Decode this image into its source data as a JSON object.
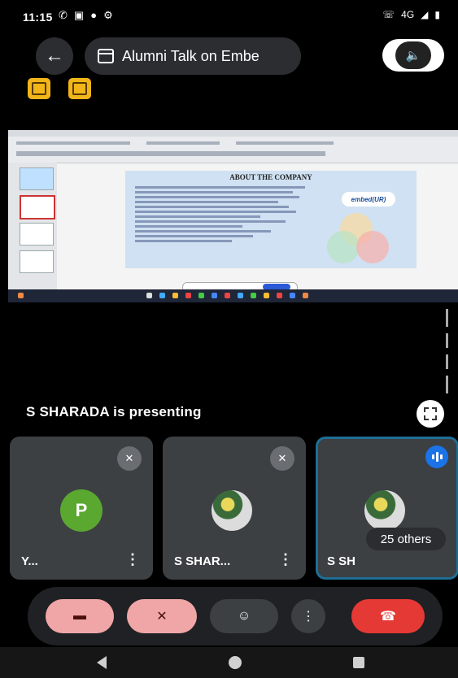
{
  "status_bar": {
    "time": "11:15",
    "left_icons": [
      "missed-call-icon",
      "calendar-31-icon",
      "chat-bubble-icon",
      "settings-icon"
    ],
    "network": "4G"
  },
  "header": {
    "meeting_title": "Alumni Talk on Embe",
    "back_label": "←",
    "speaker_glyph": "🔈"
  },
  "shared_screen": {
    "slide_heading": "ABOUT THE COMPANY",
    "logo_text": "embed(UR)"
  },
  "presenting_text": "S SHARADA is presenting",
  "participants": [
    {
      "name": "Y...",
      "avatar_letter": "P",
      "avatar_color": "#5aa830",
      "muted": true
    },
    {
      "name": "S SHAR...",
      "muted": true
    },
    {
      "name": "S SH",
      "speaking": true
    }
  ],
  "others_badge": "25 others",
  "controls": {
    "camera_off_color": "#f0a6a6",
    "mic_off_color": "#f0a6a6",
    "end_call_color": "#e53935"
  }
}
